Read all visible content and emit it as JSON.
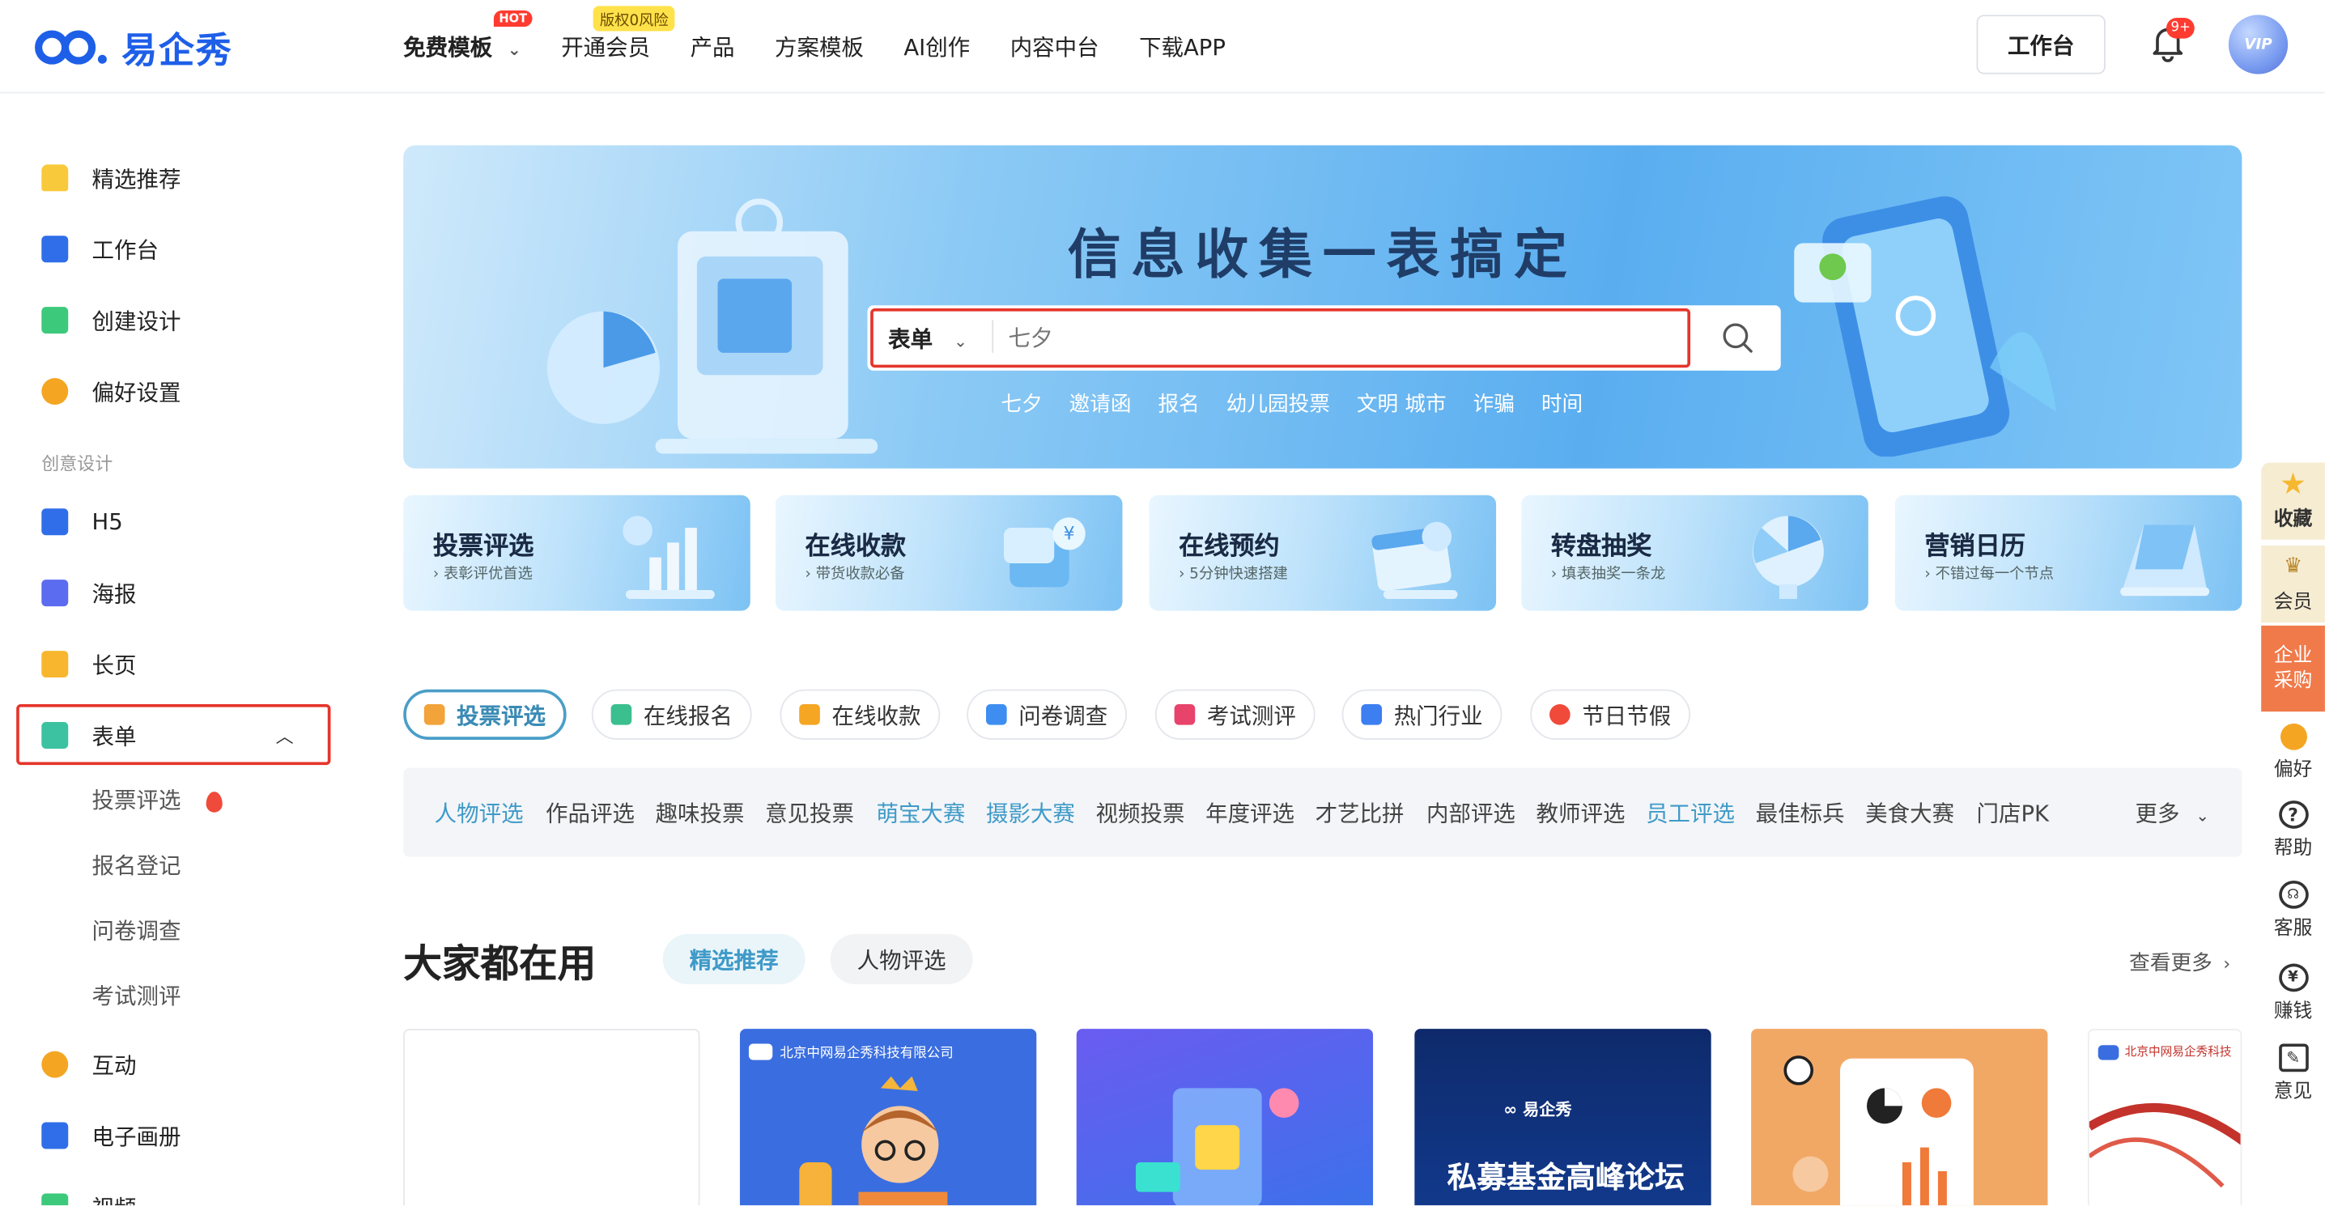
{
  "header": {
    "logo_text": "易企秀",
    "nav": [
      {
        "label": "免费模板",
        "badge": "HOT"
      },
      {
        "label": "开通会员",
        "badge": "版权0风险"
      },
      {
        "label": "产品"
      },
      {
        "label": "方案模板"
      },
      {
        "label": "AI创作"
      },
      {
        "label": "内容中台"
      },
      {
        "label": "下载APP"
      }
    ],
    "workspace_button": "工作台",
    "notification_count": "9+",
    "avatar_label": "VIP"
  },
  "sidebar": {
    "items": [
      {
        "label": "精选推荐"
      },
      {
        "label": "工作台"
      },
      {
        "label": "创建设计"
      },
      {
        "label": "偏好设置"
      }
    ],
    "section_label": "创意设计",
    "design_items": [
      {
        "label": "H5"
      },
      {
        "label": "海报"
      },
      {
        "label": "长页"
      },
      {
        "label": "表单"
      }
    ],
    "form_subitems": [
      {
        "label": "投票评选"
      },
      {
        "label": "报名登记"
      },
      {
        "label": "问卷调查"
      },
      {
        "label": "考试测评"
      }
    ],
    "more_items": [
      {
        "label": "互动"
      },
      {
        "label": "电子画册"
      },
      {
        "label": "视频"
      }
    ]
  },
  "banner": {
    "title": "信息收集一表搞定",
    "search_category": "表单",
    "search_placeholder": "七夕",
    "hot_words": [
      "七夕",
      "邀请函",
      "报名",
      "幼儿园投票",
      "文明 城市",
      "诈骗",
      "时间"
    ]
  },
  "feature_cards": [
    {
      "title": "投票评选",
      "subtitle": "表彰评优首选"
    },
    {
      "title": "在线收款",
      "subtitle": "带货收款必备"
    },
    {
      "title": "在线预约",
      "subtitle": "5分钟快速搭建"
    },
    {
      "title": "转盘抽奖",
      "subtitle": "填表抽奖一条龙"
    },
    {
      "title": "营销日历",
      "subtitle": "不错过每一个节点"
    }
  ],
  "tabs": [
    {
      "label": "投票评选",
      "color": "#f2a33a"
    },
    {
      "label": "在线报名",
      "color": "#3bbf8f"
    },
    {
      "label": "在线收款",
      "color": "#f5a623"
    },
    {
      "label": "问卷调查",
      "color": "#3d8ef0"
    },
    {
      "label": "考试测评",
      "color": "#e8436b"
    },
    {
      "label": "热门行业",
      "color": "#3d7ef0"
    },
    {
      "label": "节日节假",
      "color": "#ef4a3a"
    }
  ],
  "categories": [
    {
      "label": "人物评选",
      "highlight": true
    },
    {
      "label": "作品评选",
      "highlight": false
    },
    {
      "label": "趣味投票",
      "highlight": false
    },
    {
      "label": "意见投票",
      "highlight": false
    },
    {
      "label": "萌宝大赛",
      "highlight": true
    },
    {
      "label": "摄影大赛",
      "highlight": true
    },
    {
      "label": "视频投票",
      "highlight": false
    },
    {
      "label": "年度评选",
      "highlight": false
    },
    {
      "label": "才艺比拼",
      "highlight": false
    },
    {
      "label": "内部评选",
      "highlight": false
    },
    {
      "label": "教师评选",
      "highlight": false
    },
    {
      "label": "员工评选",
      "highlight": true
    },
    {
      "label": "最佳标兵",
      "highlight": false
    },
    {
      "label": "美食大赛",
      "highlight": false
    },
    {
      "label": "门店PK",
      "highlight": false
    }
  ],
  "categories_more": "更多",
  "section": {
    "title": "大家都在用",
    "pills": [
      "精选推荐",
      "人物评选"
    ],
    "see_more": "查看更多"
  },
  "templates": [
    {
      "caption": ""
    },
    {
      "caption": "北京中网易企秀科技有限公司"
    },
    {
      "caption": ""
    },
    {
      "caption": "私募基金高峰论坛",
      "brand": "易企秀"
    },
    {
      "caption": ""
    },
    {
      "caption": "北京中网易企秀科技"
    }
  ],
  "right_rail": [
    {
      "label": "收藏"
    },
    {
      "label": "会员"
    },
    {
      "label": "企业采购"
    },
    {
      "label": "偏好"
    },
    {
      "label": "帮助"
    },
    {
      "label": "客服"
    },
    {
      "label": "赚钱"
    },
    {
      "label": "意见"
    }
  ],
  "colors": {
    "brand": "#1e5fe8",
    "highlight_red": "#e5352b",
    "category_blue": "#3f9ac8"
  }
}
